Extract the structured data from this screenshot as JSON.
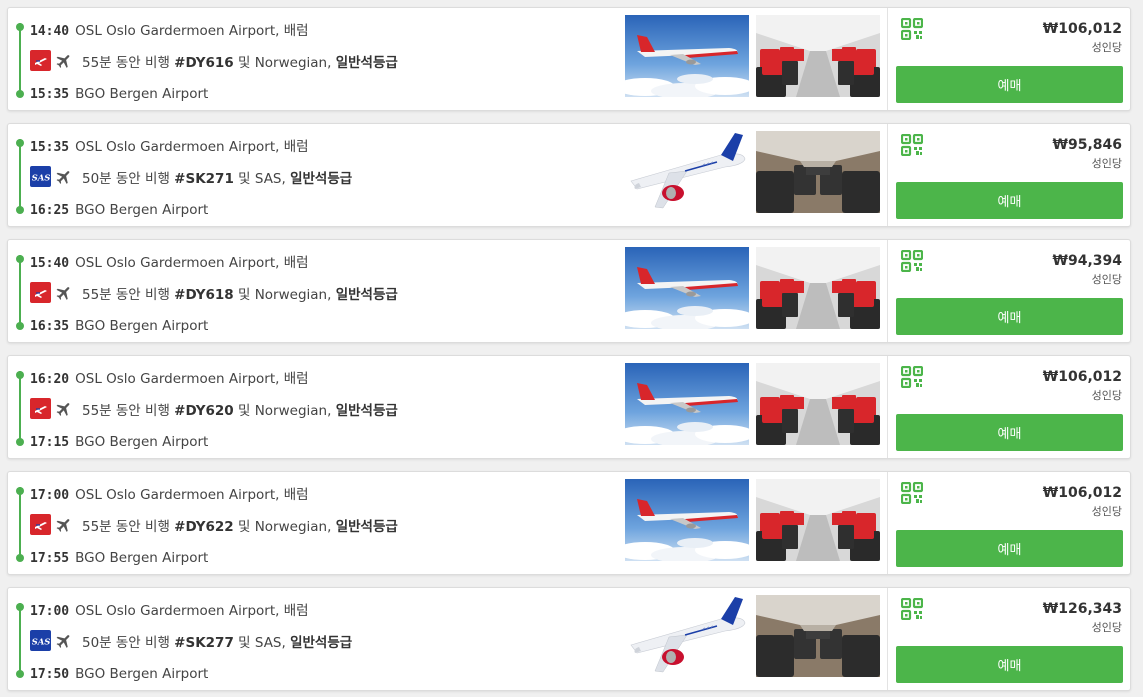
{
  "colors": {
    "accent": "#4cb54a",
    "norwegian_red": "#d8262b",
    "sas_blue": "#1b3fa8"
  },
  "flights": [
    {
      "dep_time": "14:40",
      "dep_airport": "OSL Oslo Gardermoen Airport, 배럼",
      "arr_time": "15:35",
      "arr_airport": "BGO Bergen Airport",
      "duration_text": "55분 동안 비행",
      "flight_no": "#DY616",
      "joiner": "및",
      "airline": "Norwegian,",
      "cabin": "일반석등급",
      "airline_code": "norwegian",
      "price": "₩106,012",
      "per": "성인당",
      "book": "예매"
    },
    {
      "dep_time": "15:35",
      "dep_airport": "OSL Oslo Gardermoen Airport, 배럼",
      "arr_time": "16:25",
      "arr_airport": "BGO Bergen Airport",
      "duration_text": "50분 동안 비행",
      "flight_no": "#SK271",
      "joiner": "및",
      "airline": "SAS,",
      "cabin": "일반석등급",
      "airline_code": "sas",
      "price": "₩95,846",
      "per": "성인당",
      "book": "예매"
    },
    {
      "dep_time": "15:40",
      "dep_airport": "OSL Oslo Gardermoen Airport, 배럼",
      "arr_time": "16:35",
      "arr_airport": "BGO Bergen Airport",
      "duration_text": "55분 동안 비행",
      "flight_no": "#DY618",
      "joiner": "및",
      "airline": "Norwegian,",
      "cabin": "일반석등급",
      "airline_code": "norwegian",
      "price": "₩94,394",
      "per": "성인당",
      "book": "예매"
    },
    {
      "dep_time": "16:20",
      "dep_airport": "OSL Oslo Gardermoen Airport, 배럼",
      "arr_time": "17:15",
      "arr_airport": "BGO Bergen Airport",
      "duration_text": "55분 동안 비행",
      "flight_no": "#DY620",
      "joiner": "및",
      "airline": "Norwegian,",
      "cabin": "일반석등급",
      "airline_code": "norwegian",
      "price": "₩106,012",
      "per": "성인당",
      "book": "예매"
    },
    {
      "dep_time": "17:00",
      "dep_airport": "OSL Oslo Gardermoen Airport, 배럼",
      "arr_time": "17:55",
      "arr_airport": "BGO Bergen Airport",
      "duration_text": "55분 동안 비행",
      "flight_no": "#DY622",
      "joiner": "및",
      "airline": "Norwegian,",
      "cabin": "일반석등급",
      "airline_code": "norwegian",
      "price": "₩106,012",
      "per": "성인당",
      "book": "예매"
    },
    {
      "dep_time": "17:00",
      "dep_airport": "OSL Oslo Gardermoen Airport, 배럼",
      "arr_time": "17:50",
      "arr_airport": "BGO Bergen Airport",
      "duration_text": "50분 동안 비행",
      "flight_no": "#SK277",
      "joiner": "및",
      "airline": "SAS,",
      "cabin": "일반석등급",
      "airline_code": "sas",
      "price": "₩126,343",
      "per": "성인당",
      "book": "예매"
    }
  ],
  "icons": {
    "plane": "airplane-icon",
    "qr": "qr-code-icon",
    "airline_logo_norwegian": "norwegian-logo-icon",
    "airline_logo_sas": "sas-logo-icon"
  }
}
